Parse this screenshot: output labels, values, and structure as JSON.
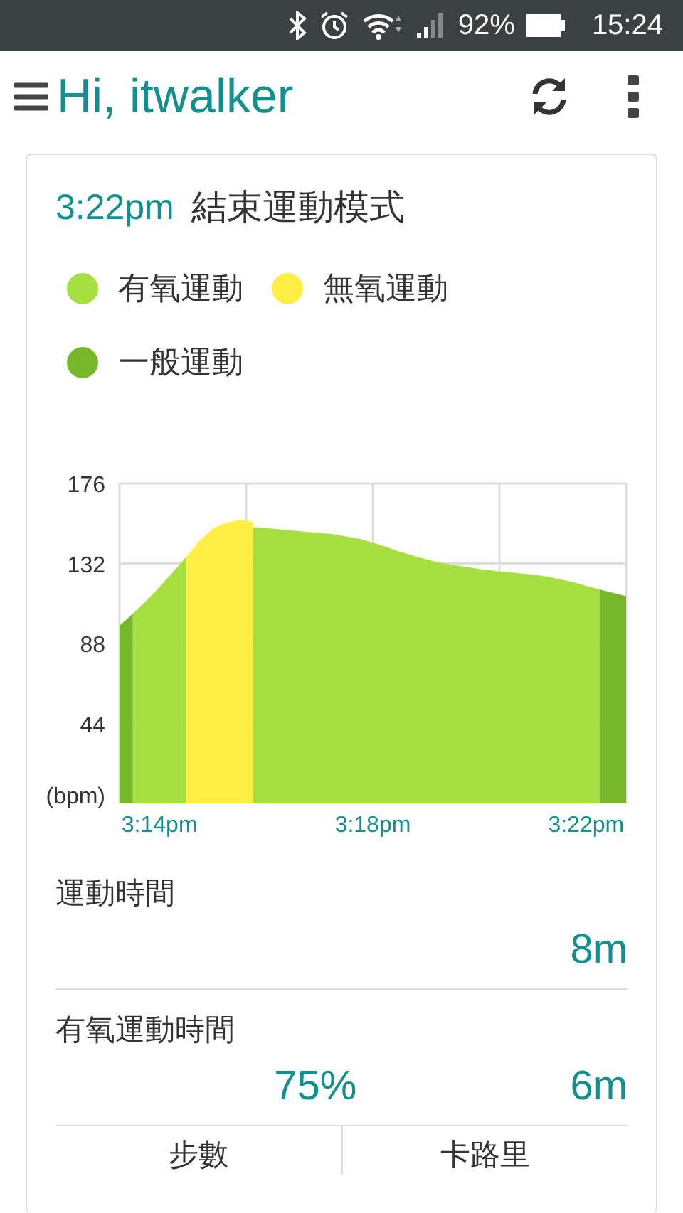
{
  "status_bar": {
    "battery": "92%",
    "time": "15:24"
  },
  "app_bar": {
    "title": "Hi, itwalker"
  },
  "session": {
    "time": "3:22pm",
    "title": "結束運動模式",
    "chart_data": {
      "type": "area",
      "ylabel": "(bpm)",
      "grid": true,
      "categories": [
        null,
        null,
        null,
        "3:14pm",
        null,
        null,
        null,
        null,
        null,
        null,
        null,
        null,
        null,
        null,
        null,
        null,
        null,
        null,
        null,
        "3:18pm",
        null,
        null,
        null,
        null,
        null,
        null,
        null,
        null,
        null,
        null,
        null,
        null,
        null,
        null,
        null,
        "3:22pm",
        null,
        null,
        null
      ],
      "yticks": [
        44,
        88,
        132,
        176
      ],
      "ylim": [
        0,
        176
      ],
      "series": [
        {
          "name": "有氧運動",
          "color": "#a6e040",
          "values": [
            null,
            104.4,
            111.4,
            119.1,
            127.3,
            135.6,
            null,
            null,
            null,
            null,
            152,
            151.5,
            150.8,
            150.1,
            149.4,
            148.8,
            148.1,
            146.9,
            145.6,
            143.5,
            141.1,
            138.6,
            136.3,
            134.3,
            132.4,
            131.2,
            130.1,
            129,
            128.1,
            127.3,
            126.6,
            125.9,
            124.9,
            123.4,
            121.8,
            119.7,
            117.7,
            null,
            null
          ]
        },
        {
          "name": "無氧運動",
          "color": "#ffee44",
          "values": [
            null,
            null,
            null,
            null,
            null,
            135.6,
            144.4,
            151.2,
            154.5,
            155.9,
            155,
            null,
            null,
            null,
            null,
            null,
            null,
            null,
            null,
            null,
            null,
            null,
            null,
            null,
            null,
            null,
            null,
            null,
            null,
            null,
            null,
            null,
            null,
            null,
            null,
            null,
            null,
            null,
            null
          ]
        },
        {
          "name": "一般運動",
          "color": "#76b82a",
          "values": [
            97.8,
            104.4,
            null,
            null,
            null,
            null,
            null,
            null,
            null,
            null,
            null,
            null,
            null,
            null,
            null,
            null,
            null,
            null,
            null,
            null,
            null,
            null,
            null,
            null,
            null,
            null,
            null,
            null,
            null,
            null,
            null,
            null,
            null,
            null,
            null,
            null,
            117.7,
            115.9,
            114
          ]
        }
      ]
    }
  },
  "stats": [
    {
      "label": "運動時間",
      "values": [
        "8m"
      ]
    },
    {
      "label": "有氧運動時間",
      "values": [
        "75%",
        "6m"
      ]
    }
  ],
  "table": {
    "columns": [
      "步數",
      "卡路里"
    ]
  }
}
